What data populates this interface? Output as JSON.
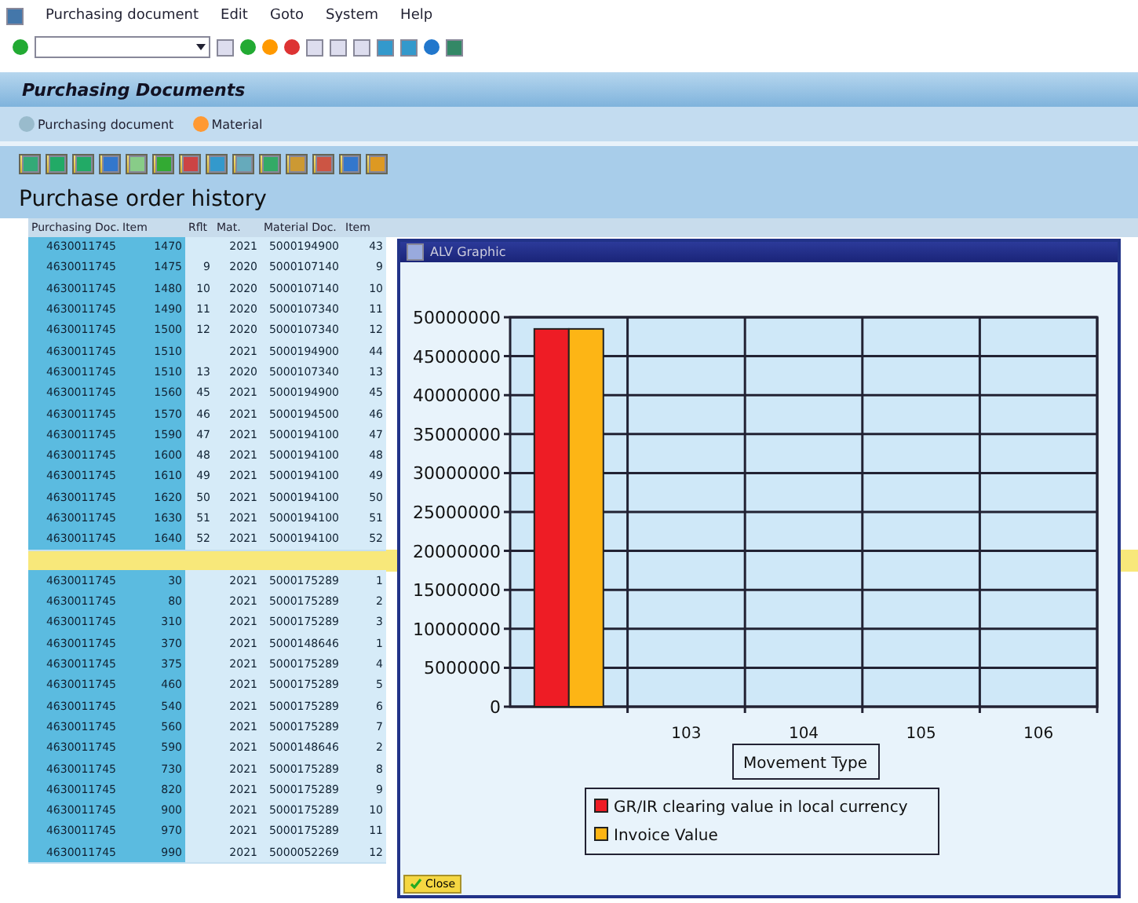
{
  "menu": [
    "Purchasing document",
    "Edit",
    "Goto",
    "System",
    "Help"
  ],
  "title": "Purchasing Documents",
  "app_toolbar": [
    {
      "label": "Purchasing document",
      "kind": "search"
    },
    {
      "label": "Material",
      "kind": "material"
    }
  ],
  "section_title": "Purchase order history",
  "table": {
    "columns": [
      "Purchasing Doc.",
      "Item",
      "Rflt",
      "Mat.",
      "Material Doc.",
      "Item"
    ],
    "rows": [
      {
        "kind": "row",
        "cells": [
          "4630011745",
          "1470",
          "",
          "2021",
          "5000194900",
          "43"
        ]
      },
      {
        "kind": "row",
        "cells": [
          "4630011745",
          "1475",
          "9",
          "2020",
          "5000107140",
          "9"
        ]
      },
      {
        "kind": "row",
        "cells": [
          "4630011745",
          "1480",
          "10",
          "2020",
          "5000107140",
          "10"
        ]
      },
      {
        "kind": "row",
        "cells": [
          "4630011745",
          "1490",
          "11",
          "2020",
          "5000107340",
          "11"
        ]
      },
      {
        "kind": "row",
        "cells": [
          "4630011745",
          "1500",
          "12",
          "2020",
          "5000107340",
          "12"
        ]
      },
      {
        "kind": "row",
        "cells": [
          "4630011745",
          "1510",
          "",
          "2021",
          "5000194900",
          "44"
        ]
      },
      {
        "kind": "row",
        "cells": [
          "4630011745",
          "1510",
          "13",
          "2020",
          "5000107340",
          "13"
        ]
      },
      {
        "kind": "row",
        "cells": [
          "4630011745",
          "1560",
          "45",
          "2021",
          "5000194900",
          "45"
        ]
      },
      {
        "kind": "row",
        "cells": [
          "4630011745",
          "1570",
          "46",
          "2021",
          "5000194500",
          "46"
        ]
      },
      {
        "kind": "row",
        "cells": [
          "4630011745",
          "1590",
          "47",
          "2021",
          "5000194100",
          "47"
        ]
      },
      {
        "kind": "row",
        "cells": [
          "4630011745",
          "1600",
          "48",
          "2021",
          "5000194100",
          "48"
        ]
      },
      {
        "kind": "row",
        "cells": [
          "4630011745",
          "1610",
          "49",
          "2021",
          "5000194100",
          "49"
        ]
      },
      {
        "kind": "row",
        "cells": [
          "4630011745",
          "1620",
          "50",
          "2021",
          "5000194100",
          "50"
        ]
      },
      {
        "kind": "row",
        "cells": [
          "4630011745",
          "1630",
          "51",
          "2021",
          "5000194100",
          "51"
        ]
      },
      {
        "kind": "row",
        "cells": [
          "4630011745",
          "1640",
          "52",
          "2021",
          "5000194100",
          "52"
        ]
      },
      {
        "kind": "subtotal",
        "cells": [
          "",
          "",
          "",
          "",
          "",
          ""
        ]
      },
      {
        "kind": "row",
        "cells": [
          "4630011745",
          "30",
          "",
          "2021",
          "5000175289",
          "1"
        ]
      },
      {
        "kind": "row",
        "cells": [
          "4630011745",
          "80",
          "",
          "2021",
          "5000175289",
          "2"
        ]
      },
      {
        "kind": "row",
        "cells": [
          "4630011745",
          "310",
          "",
          "2021",
          "5000175289",
          "3"
        ]
      },
      {
        "kind": "row",
        "cells": [
          "4630011745",
          "370",
          "",
          "2021",
          "5000148646",
          "1"
        ]
      },
      {
        "kind": "row",
        "cells": [
          "4630011745",
          "375",
          "",
          "2021",
          "5000175289",
          "4"
        ]
      },
      {
        "kind": "row",
        "cells": [
          "4630011745",
          "460",
          "",
          "2021",
          "5000175289",
          "5"
        ]
      },
      {
        "kind": "row",
        "cells": [
          "4630011745",
          "540",
          "",
          "2021",
          "5000175289",
          "6"
        ]
      },
      {
        "kind": "row",
        "cells": [
          "4630011745",
          "560",
          "",
          "2021",
          "5000175289",
          "7"
        ]
      },
      {
        "kind": "row",
        "cells": [
          "4630011745",
          "590",
          "",
          "2021",
          "5000148646",
          "2"
        ]
      },
      {
        "kind": "row",
        "cells": [
          "4630011745",
          "730",
          "",
          "2021",
          "5000175289",
          "8"
        ]
      },
      {
        "kind": "row",
        "cells": [
          "4630011745",
          "820",
          "",
          "2021",
          "5000175289",
          "9"
        ]
      },
      {
        "kind": "row",
        "cells": [
          "4630011745",
          "900",
          "",
          "2021",
          "5000175289",
          "10"
        ]
      },
      {
        "kind": "row",
        "cells": [
          "4630011745",
          "970",
          "",
          "2021",
          "5000175289",
          "11"
        ]
      },
      {
        "kind": "row",
        "cells": [
          "4630011745",
          "990",
          "",
          "2021",
          "5000052269",
          "12"
        ]
      }
    ]
  },
  "popup": {
    "title": "ALV Graphic",
    "close_button": "Close",
    "chart_data": {
      "type": "bar",
      "xlabel": "Movement Type",
      "categories": [
        null,
        "103",
        "104",
        "105",
        "106"
      ],
      "series": [
        {
          "name": "GR/IR clearing value in local currency",
          "color": "#ee1c25",
          "values": [
            48500000,
            null,
            null,
            null,
            null
          ]
        },
        {
          "name": "Invoice Value",
          "color": "#fdb515",
          "values": [
            48500000,
            null,
            null,
            null,
            null
          ]
        }
      ],
      "grid": true,
      "legend": true,
      "ylim": [
        0,
        50000000
      ],
      "yticks": [
        0,
        5000000,
        10000000,
        15000000,
        20000000,
        25000000,
        30000000,
        35000000,
        40000000,
        45000000,
        50000000
      ]
    }
  }
}
